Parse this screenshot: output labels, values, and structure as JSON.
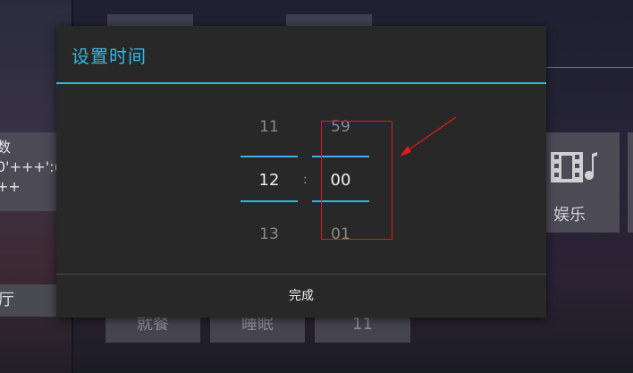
{
  "background": {
    "left_panel_lines": [
      "数",
      "0'+++':(",
      "++"
    ],
    "left_bottom_label": "厅",
    "entertainment_label": "娱乐",
    "bottom_tiles": [
      "就餐",
      "睡眠",
      "11"
    ]
  },
  "dialog": {
    "title": "设置时间",
    "hour": {
      "prev": "11",
      "selected": "12",
      "next": "13"
    },
    "separator": ":",
    "minute": {
      "prev": "59",
      "selected": "00",
      "next": "01"
    },
    "done_label": "完成"
  },
  "colors": {
    "accent": "#33b5e5",
    "dialog_bg": "#282828",
    "annotation_red": "#e0191b"
  }
}
